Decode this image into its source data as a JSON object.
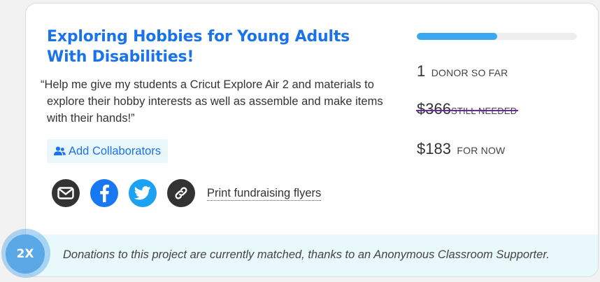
{
  "project": {
    "title": "Exploring Hobbies for Young Adults With Disabilities!",
    "quote_open": "“",
    "quote": "Help me give my students a Cricut Explore Air 2 and materials to explore their hobby interests as well as assemble and make items with their hands!",
    "quote_close": "”"
  },
  "actions": {
    "add_collaborators_label": "Add Collaborators",
    "print_flyers_label": "Print fundraising flyers",
    "share_icons": [
      "email-icon",
      "facebook-icon",
      "twitter-icon",
      "link-icon"
    ]
  },
  "funding": {
    "progress_percent": 50,
    "donor_count": "1",
    "donor_label": "DONOR SO FAR",
    "still_needed_amount": "$366",
    "still_needed_label": "STILL NEEDED",
    "for_now_amount": "$183",
    "for_now_label": "FOR NOW"
  },
  "match": {
    "badge": "2X",
    "text": "Donations to this project are currently matched, thanks to an Anonymous Classroom Supporter."
  },
  "colors": {
    "title": "#1a73e8",
    "progress": "#3ba7f0",
    "strike": "#6a2aa8",
    "match_bg": "#e9f9fb",
    "badge": "#5aa9e6"
  }
}
